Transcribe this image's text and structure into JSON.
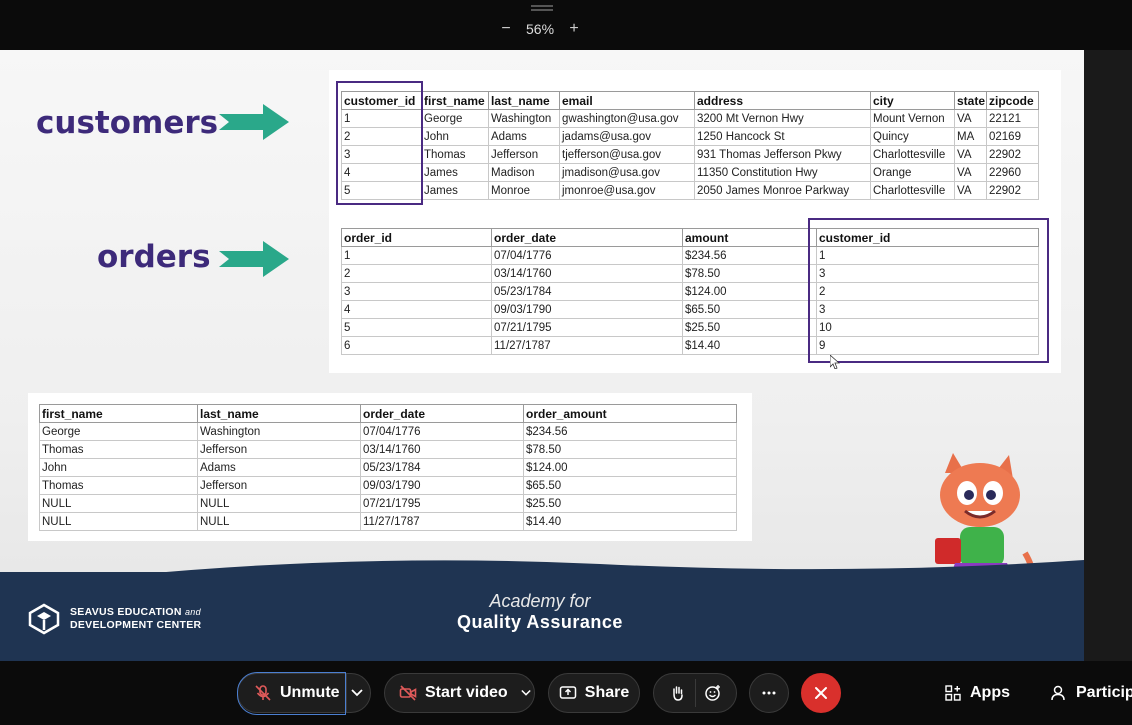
{
  "zoom": {
    "minus_label": "−",
    "level": "56%",
    "plus_label": "+"
  },
  "slide": {
    "customers_label": "customers",
    "orders_label": "orders",
    "customers_table": {
      "headers": [
        "customer_id",
        "first_name",
        "last_name",
        "email",
        "address",
        "city",
        "state",
        "zipcode"
      ],
      "rows": [
        [
          "1",
          "George",
          "Washington",
          "gwashington@usa.gov",
          "3200 Mt Vernon Hwy",
          "Mount Vernon",
          "VA",
          "22121"
        ],
        [
          "2",
          "John",
          "Adams",
          "jadams@usa.gov",
          "1250 Hancock St",
          "Quincy",
          "MA",
          "02169"
        ],
        [
          "3",
          "Thomas",
          "Jefferson",
          "tjefferson@usa.gov",
          "931 Thomas Jefferson Pkwy",
          "Charlottesville",
          "VA",
          "22902"
        ],
        [
          "4",
          "James",
          "Madison",
          "jmadison@usa.gov",
          "11350 Constitution Hwy",
          "Orange",
          "VA",
          "22960"
        ],
        [
          "5",
          "James",
          "Monroe",
          "jmonroe@usa.gov",
          "2050 James Monroe Parkway",
          "Charlottesville",
          "VA",
          "22902"
        ]
      ]
    },
    "orders_table": {
      "headers": [
        "order_id",
        "order_date",
        "amount",
        "customer_id"
      ],
      "rows": [
        [
          "1",
          "07/04/1776",
          "$234.56",
          "1"
        ],
        [
          "2",
          "03/14/1760",
          "$78.50",
          "3"
        ],
        [
          "3",
          "05/23/1784",
          "$124.00",
          "2"
        ],
        [
          "4",
          "09/03/1790",
          "$65.50",
          "3"
        ],
        [
          "5",
          "07/21/1795",
          "$25.50",
          "10"
        ],
        [
          "6",
          "11/27/1787",
          "$14.40",
          "9"
        ]
      ]
    },
    "result_table": {
      "headers": [
        "first_name",
        "last_name",
        "order_date",
        "order_amount"
      ],
      "rows": [
        [
          "George",
          "Washington",
          "07/04/1776",
          "$234.56"
        ],
        [
          "Thomas",
          "Jefferson",
          "03/14/1760",
          "$78.50"
        ],
        [
          "John",
          "Adams",
          "05/23/1784",
          "$124.00"
        ],
        [
          "Thomas",
          "Jefferson",
          "09/03/1790",
          "$65.50"
        ],
        [
          "NULL",
          "NULL",
          "07/21/1795",
          "$25.50"
        ],
        [
          "NULL",
          "NULL",
          "11/27/1787",
          "$14.40"
        ]
      ]
    },
    "footer": {
      "company_line1": "SEAVUS EDUCATION",
      "company_and": "and",
      "company_line2": "DEVELOPMENT CENTER",
      "academy_line1": "Academy for",
      "academy_line2": "Quality Assurance"
    },
    "accent_color": "#3d2a7a",
    "arrow_color": "#2aa88a"
  },
  "toolbar": {
    "unmute_label": "Unmute",
    "start_video_label": "Start video",
    "share_label": "Share",
    "apps_label": "Apps",
    "participants_label": "Particip",
    "end_color": "#d9302c"
  }
}
